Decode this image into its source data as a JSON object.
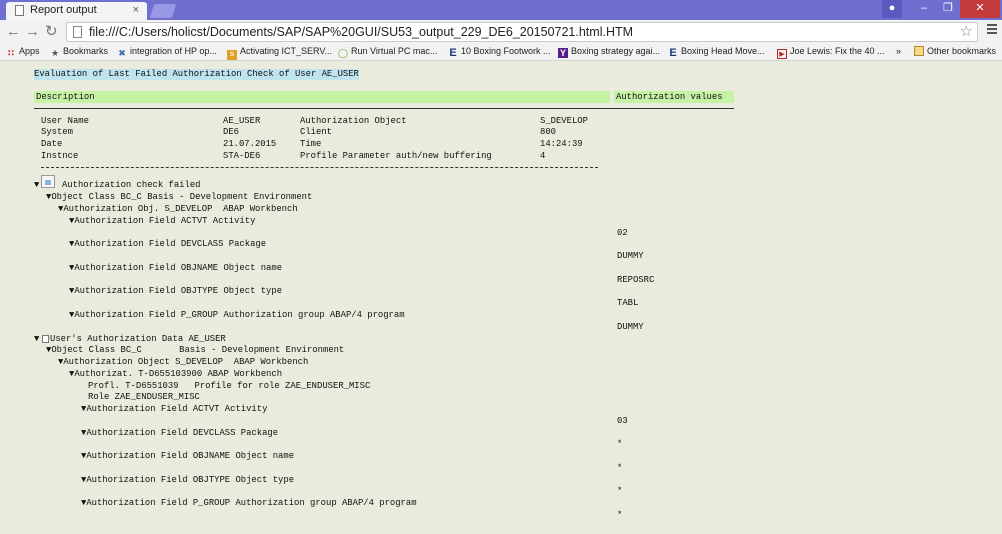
{
  "browser": {
    "tab_title": "Report output",
    "tab_close": "×",
    "url": "file:///C:/Users/holicst/Documents/SAP/SAP%20GUI/SU53_output_229_DE6_20150721.html.HTM",
    "bookmarks": [
      {
        "label": "Apps",
        "icon": "apps-grid-icon"
      },
      {
        "label": "Bookmarks",
        "icon": "star-icon"
      },
      {
        "label": "integration of HP op...",
        "icon": "hp-icon"
      },
      {
        "label": "Activating ICT_SERV...",
        "icon": "sap-icon"
      },
      {
        "label": "Run Virtual PC mac...",
        "icon": "circle-icon"
      },
      {
        "label": "10 Boxing Footwork ...",
        "icon": "e-icon"
      },
      {
        "label": "Boxing strategy agai...",
        "icon": "yahoo-icon"
      },
      {
        "label": "Boxing Head Move...",
        "icon": "e-icon"
      },
      {
        "label": "Joe Lewis: Fix the 40 ...",
        "icon": "video-icon"
      }
    ],
    "overflow": "»",
    "other_bookmarks": "Other bookmarks"
  },
  "report": {
    "title": "Evaluation of Last Failed Authorization Check of User AE_USER",
    "col_description": "Description",
    "col_auth_values": "Authorization values",
    "header_rows": [
      {
        "label": "User Name",
        "value": "AE_USER",
        "label2": "Authorization Object",
        "value2": "S_DEVELOP"
      },
      {
        "label": "System",
        "value": "DE6",
        "label2": "Client",
        "value2": "800"
      },
      {
        "label": "Date",
        "value": "21.07.2015",
        "label2": "Time",
        "value2": "14:24:39"
      },
      {
        "label": "Instnce",
        "value": "STA-DE6",
        "label2": "Profile Parameter auth/new buffering",
        "value2": "4"
      }
    ],
    "tree": [
      {
        "text": "▼",
        "key": "n0"
      },
      {
        "text": "Authorization check failed",
        "key": "n1"
      },
      {
        "text": "▼Object Class BC_C Basis - Development Environment",
        "key": "n2"
      },
      {
        "text": "▼Authorization Obj. S_DEVELOP  ABAP Workbench",
        "key": "n3"
      },
      {
        "text": "▼Authorization Field ACTVT Activity",
        "key": "n4"
      },
      {
        "text": "02",
        "key": "v1"
      },
      {
        "text": "▼Authorization Field DEVCLASS Package",
        "key": "n5"
      },
      {
        "text": "DUMMY",
        "key": "v2"
      },
      {
        "text": "▼Authorization Field OBJNAME Object name",
        "key": "n6"
      },
      {
        "text": "REPOSRC",
        "key": "v3"
      },
      {
        "text": "▼Authorization Field OBJTYPE Object type",
        "key": "n7"
      },
      {
        "text": "TABL",
        "key": "v4"
      },
      {
        "text": "▼Authorization Field P_GROUP Authorization group ABAP/4 program",
        "key": "n8"
      },
      {
        "text": "DUMMY",
        "key": "v5"
      },
      {
        "text": "▼",
        "key": "n9"
      },
      {
        "text": "User's Authorization Data AE_USER",
        "key": "n10"
      },
      {
        "text": "▼Object Class BC_C       Basis - Development Environment",
        "key": "n11"
      },
      {
        "text": "▼Authorization Object S_DEVELOP  ABAP Workbench",
        "key": "n12"
      },
      {
        "text": "▼Authorizat. T-D655103900 ABAP Workbench",
        "key": "n13"
      },
      {
        "text": "Profl. T-D6551039   Profile for role ZAE_ENDUSER_MISC",
        "key": "n14"
      },
      {
        "text": "Role ZAE_ENDUSER_MISC",
        "key": "n15"
      },
      {
        "text": "▼Authorization Field ACTVT Activity",
        "key": "n16"
      },
      {
        "text": "03",
        "key": "v6"
      },
      {
        "text": "▼Authorization Field DEVCLASS Package",
        "key": "n17"
      },
      {
        "text": "*",
        "key": "v7"
      },
      {
        "text": "▼Authorization Field OBJNAME Object name",
        "key": "n18"
      },
      {
        "text": "*",
        "key": "v8"
      },
      {
        "text": "▼Authorization Field OBJTYPE Object type",
        "key": "n19"
      },
      {
        "text": "*",
        "key": "v9"
      },
      {
        "text": "▼Authorization Field P_GROUP Authorization group ABAP/4 program",
        "key": "n20"
      },
      {
        "text": "*",
        "key": "v10"
      }
    ]
  },
  "colors": {
    "page_bg": "#e9ecdc",
    "title_highlight": "#bfe3ef",
    "header_bar": "#c6f2a4",
    "tab_strip": "#6f6fd0"
  }
}
